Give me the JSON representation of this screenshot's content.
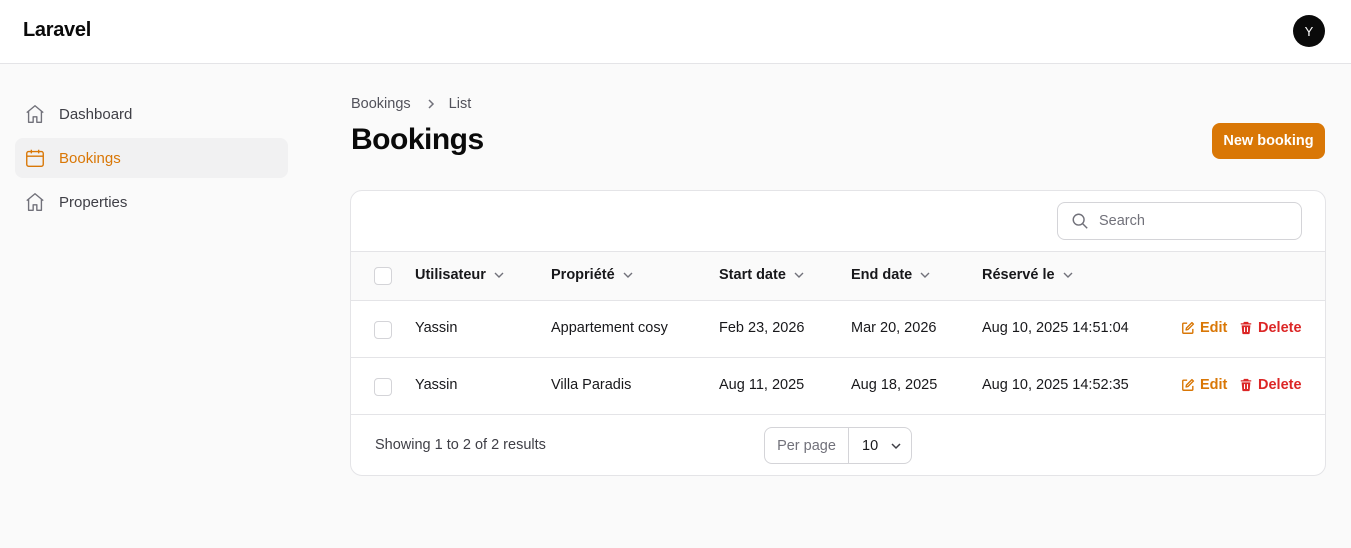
{
  "app": {
    "brand": "Laravel",
    "user_initial": "Y"
  },
  "sidebar": {
    "items": [
      {
        "label": "Dashboard",
        "icon": "home-icon",
        "active": false
      },
      {
        "label": "Bookings",
        "icon": "calendar-icon",
        "active": true
      },
      {
        "label": "Properties",
        "icon": "home-icon",
        "active": false
      }
    ]
  },
  "breadcrumb": {
    "items": [
      "Bookings",
      "List"
    ]
  },
  "page": {
    "title": "Bookings",
    "new_button": "New booking"
  },
  "table": {
    "search_placeholder": "Search",
    "columns": [
      "Utilisateur",
      "Propriété",
      "Start date",
      "End date",
      "Réservé le"
    ],
    "rows": [
      {
        "user": "Yassin",
        "property": "Appartement cosy",
        "start": "Feb 23, 2026",
        "end": "Mar 20, 2026",
        "reserved": "Aug 10, 2025 14:51:04"
      },
      {
        "user": "Yassin",
        "property": "Villa Paradis",
        "start": "Aug 11, 2025",
        "end": "Aug 18, 2025",
        "reserved": "Aug 10, 2025 14:52:35"
      }
    ],
    "actions": {
      "edit": "Edit",
      "delete": "Delete"
    },
    "footer": {
      "summary": "Showing 1 to 2 of 2 results",
      "per_page_label": "Per page",
      "per_page_value": "10"
    }
  },
  "colors": {
    "accent": "#d97706",
    "danger": "#dc2626",
    "background": "#fafafa"
  }
}
